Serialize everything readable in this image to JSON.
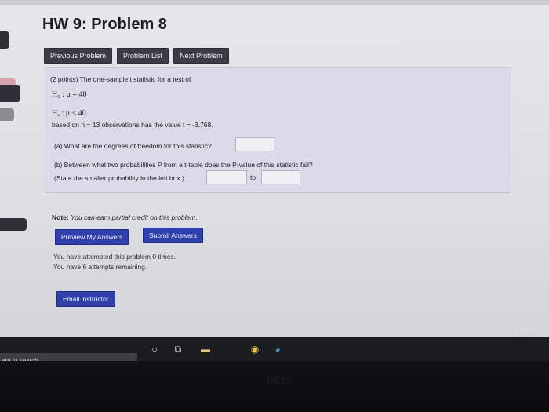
{
  "page": {
    "title": "HW 9: Problem 8"
  },
  "nav": {
    "previous": "Previous Problem",
    "list": "Problem List",
    "next": "Next Problem"
  },
  "problem": {
    "intro": "(2 points) The one-sample t statistic for a test of",
    "h0": "H₀ : μ = 40",
    "ha": "Hₐ : μ < 40",
    "based_on": "based on n = 13 observations has the value t = -3.768.",
    "part_a": "(a) What are the degrees of freedom for this statistic?",
    "part_a_value": "",
    "part_b": "(b) Between what two probabilities P from a t-table does the P-value of this statistic fall?",
    "part_b_hint": "(State the smaller probability in the left box.)",
    "part_b_to": "to",
    "part_b_low_value": "",
    "part_b_high_value": ""
  },
  "note": {
    "label": "Note:",
    "text": "You can earn partial credit on this problem."
  },
  "buttons": {
    "preview": "Preview My Answers",
    "submit": "Submit Answers",
    "email": "Email instructor"
  },
  "attempts": {
    "line1": "You have attempted this problem 0 times.",
    "line2": "You have 6 attempts remaining."
  },
  "taskbar": {
    "search_placeholder": "ere to search",
    "icons": [
      "cortana-icon",
      "task-view-icon",
      "file-explorer-icon",
      "chrome-icon",
      "edge-icon"
    ]
  },
  "hardware": {
    "brand": "DELL"
  }
}
